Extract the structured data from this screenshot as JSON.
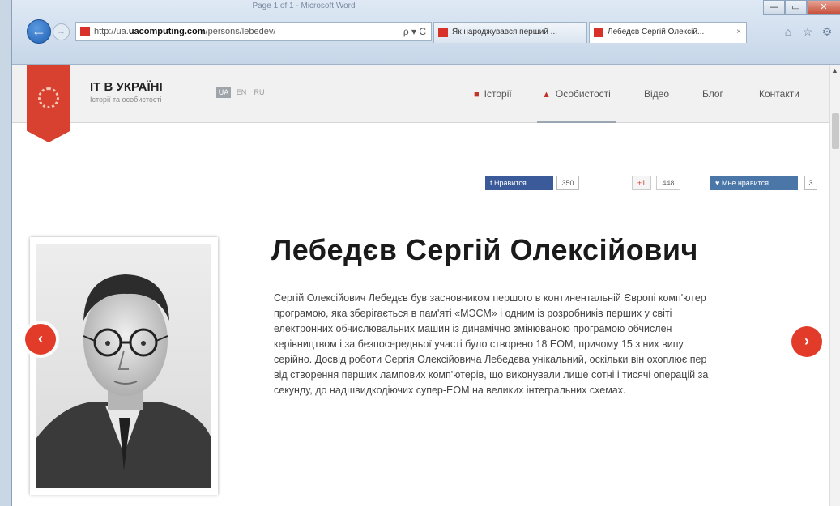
{
  "browser": {
    "title_strip": "Page 1 of 1 - Microsoft Word",
    "address": {
      "prefix": "http://ua.",
      "host": "uacomputing.com",
      "path": "/persons/lebedev/",
      "tools": "ρ ▾ C"
    },
    "tabs": [
      {
        "label": "Як народжувався перший ..."
      },
      {
        "label": "Лебедєв Сергій Олексій...",
        "close": "×"
      }
    ],
    "icons": [
      "home-icon",
      "star-icon",
      "settings-icon"
    ],
    "window_controls": [
      "—",
      "▭",
      "✕"
    ]
  },
  "site": {
    "name": "IT В УКРАЇНІ",
    "tagline": "Історії та особистості",
    "languages": [
      "UA",
      "EN",
      "RU"
    ],
    "nav": [
      {
        "label": "Історії",
        "icon": "bookmark-icon"
      },
      {
        "label": "Особистості",
        "icon": "person-icon"
      },
      {
        "label": "Відео"
      },
      {
        "label": "Блог"
      },
      {
        "label": "Контакти"
      }
    ],
    "accent": "#d8412f"
  },
  "social": {
    "facebook_label": "Нравится",
    "facebook_count": "350",
    "gplus_label": "+1",
    "gplus_count": "448",
    "vk_label": "Мне нравится",
    "vk_count": "3"
  },
  "person": {
    "name": "Лебедєв Сергій Олексійович",
    "bio_lines": [
      "Сергій Олексійович Лебедєв був засновником першого в континентальній Європі комп'ютер",
      "програмою, яка зберігається в пам'яті «МЭСМ» і одним із розробників перших у світі",
      "електронних обчислювальних машин із динамічно змінюваною програмою обчислен",
      "керівництвом і за безпосередньої участі було створено 18 ЕОМ, причому 15 з них випу",
      "серійно. Досвід роботи Сергія Олексійовича Лебедєва унікальний, оскільки він охоплює пер",
      "від створення перших лампових комп'ютерів, що виконували лише сотні і тисячі операцій за",
      "секунду, до надшвидкодіючих супер-ЕОМ на великих інтегральних схемах."
    ]
  },
  "carousel": {
    "prev": "‹",
    "next": "›"
  }
}
